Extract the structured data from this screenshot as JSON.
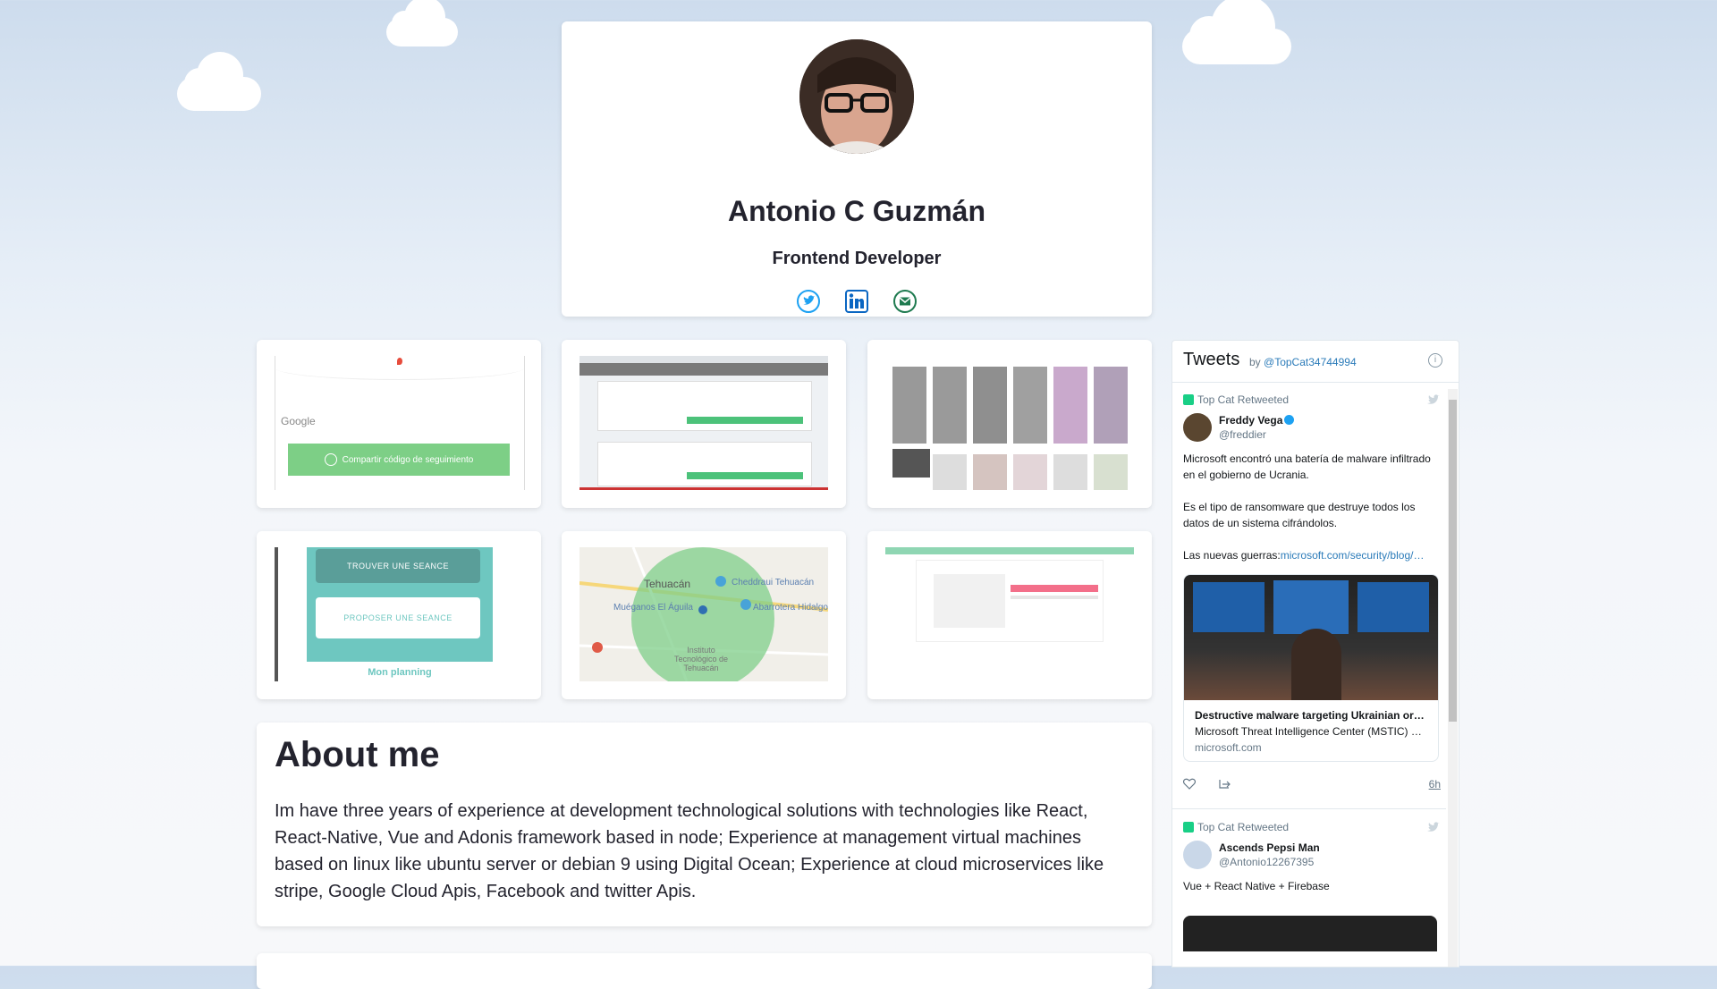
{
  "profile": {
    "name": "Antonio C Guzmán",
    "role": "Frontend Developer",
    "socials": [
      "twitter-icon",
      "linkedin-icon",
      "email-icon"
    ]
  },
  "projects": [
    {
      "thumb": "whatsapp-tracking-screenshot",
      "button_label": "Compartir código de seguimiento",
      "logo_text": "Google"
    },
    {
      "thumb": "admin-panel-screenshot"
    },
    {
      "thumb": "image-gallery-screenshot"
    },
    {
      "thumb": "seance-app-screenshot",
      "btn1": "TROUVER UNE SEANCE",
      "btn2": "PROPOSER UNE SEANCE",
      "caption": "Mon planning"
    },
    {
      "thumb": "map-screenshot",
      "labels": [
        "Tehuacán",
        "Cheddraui Tehuacán",
        "Muéganos El Águila",
        "Abarrotera Hidalgo",
        "Instituto Tecnológico de Tehuacán"
      ]
    },
    {
      "thumb": "dashboard-screenshot"
    }
  ],
  "about": {
    "title": "About me",
    "text": "Im have three years of experience at development technological solutions with technologies like React, React-Native, Vue and Adonis framework based in node; Experience at management virtual machines based on linux like ubuntu server or debian 9 using Digital Ocean; Experience at cloud microservices like stripe, Google Cloud Apis, Facebook and twitter Apis."
  },
  "tweets": {
    "title": "Tweets",
    "by_label": "by",
    "by_handle": "@TopCat34744994",
    "items": [
      {
        "retweet_label": "Top Cat Retweeted",
        "author": "Freddy Vega",
        "handle": "@freddier",
        "text": "Microsoft encontró una batería de malware infiltrado en el gobierno de Ucrania.\n\nEs el tipo de ransomware que destruye todos los datos de un sistema cifrándolos.\n\nLas nuevas guerras:",
        "link_text": "microsoft.com/security/blog/…",
        "card_title": "Destructive malware targeting Ukrainian or…",
        "card_desc": "Microsoft Threat Intelligence Center (MSTIC) …",
        "card_domain": "microsoft.com",
        "time": "6h"
      },
      {
        "retweet_label": "Top Cat Retweeted",
        "author": "Ascends Pepsi Man",
        "handle": "@Antonio12267395",
        "text": "Vue + React Native + Firebase"
      }
    ]
  },
  "colors": {
    "accent": "#1da1f2",
    "linkedin": "#0a66c2",
    "email": "#1e7a4f",
    "green_button": "#7dcf86",
    "teal": "#6ec7c0"
  }
}
